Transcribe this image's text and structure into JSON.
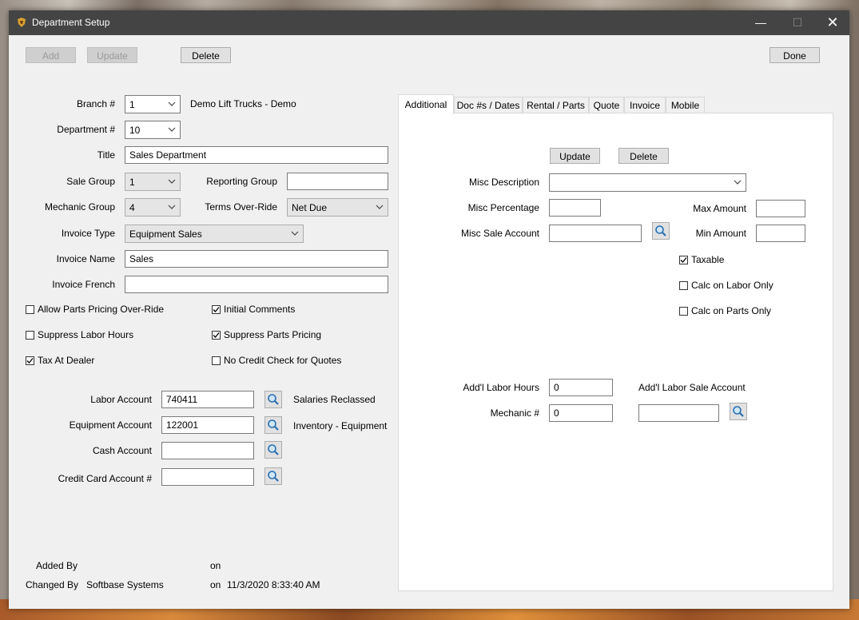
{
  "window": {
    "title": "Department Setup"
  },
  "toolbar": {
    "add": "Add",
    "update": "Update",
    "delete": "Delete",
    "done": "Done"
  },
  "form": {
    "branch_label": "Branch #",
    "branch_value": "1",
    "branch_name": "Demo Lift Trucks - Demo",
    "department_label": "Department #",
    "department_value": "10",
    "title_label": "Title",
    "title_value": "Sales Department",
    "sale_group_label": "Sale Group",
    "sale_group_value": "1",
    "reporting_group_label": "Reporting Group",
    "reporting_group_value": "",
    "mechanic_group_label": "Mechanic Group",
    "mechanic_group_value": "4",
    "terms_label": "Terms Over-Ride",
    "terms_value": "Net Due",
    "invoice_type_label": "Invoice Type",
    "invoice_type_value": "Equipment Sales",
    "invoice_name_label": "Invoice Name",
    "invoice_name_value": "Sales",
    "invoice_french_label": "Invoice French",
    "invoice_french_value": ""
  },
  "checkboxes": {
    "allow_parts": {
      "label": "Allow Parts Pricing Over-Ride",
      "checked": false
    },
    "initial_comments": {
      "label": "Initial Comments",
      "checked": true
    },
    "suppress_labor": {
      "label": "Suppress Labor Hours",
      "checked": false
    },
    "suppress_parts": {
      "label": "Suppress Parts Pricing",
      "checked": true
    },
    "tax_dealer": {
      "label": "Tax At Dealer",
      "checked": true
    },
    "no_credit": {
      "label": "No Credit Check for Quotes",
      "checked": false
    }
  },
  "accounts": {
    "labor_label": "Labor Account",
    "labor_value": "740411",
    "labor_desc": "Salaries Reclassed",
    "equipment_label": "Equipment Account",
    "equipment_value": "122001",
    "equipment_desc": "Inventory - Equipment",
    "cash_label": "Cash Account",
    "cash_value": "",
    "credit_label": "Credit Card Account #",
    "credit_value": ""
  },
  "audit": {
    "added_by_label": "Added By",
    "added_on_label": "on",
    "changed_by_label": "Changed By",
    "changed_by_value": "Softbase Systems",
    "changed_on_label": "on",
    "changed_on_value": "11/3/2020 8:33:40 AM"
  },
  "tabs": [
    "Additional",
    "Doc #s / Dates",
    "Rental / Parts",
    "Quote",
    "Invoice",
    "Mobile"
  ],
  "additional": {
    "update": "Update",
    "delete": "Delete",
    "misc_desc_label": "Misc Description",
    "misc_desc_value": "",
    "misc_pct_label": "Misc Percentage",
    "misc_pct_value": "",
    "max_amount_label": "Max Amount",
    "max_amount_value": "",
    "misc_sale_label": "Misc Sale Account",
    "misc_sale_value": "",
    "min_amount_label": "Min Amount",
    "min_amount_value": "",
    "taxable": {
      "label": "Taxable",
      "checked": true
    },
    "calc_labor": {
      "label": "Calc on Labor Only",
      "checked": false
    },
    "calc_parts": {
      "label": "Calc on Parts Only",
      "checked": false
    },
    "addl_labor_hours_label": "Add'l Labor Hours",
    "addl_labor_hours_value": "0",
    "addl_labor_sale_label": "Add'l Labor Sale Account",
    "addl_labor_sale_value": "",
    "mechanic_label": "Mechanic #",
    "mechanic_value": "0"
  },
  "colors": {
    "titlebar": "#444444",
    "window_bg": "#f0f0f0",
    "panel_bg": "#ffffff"
  }
}
